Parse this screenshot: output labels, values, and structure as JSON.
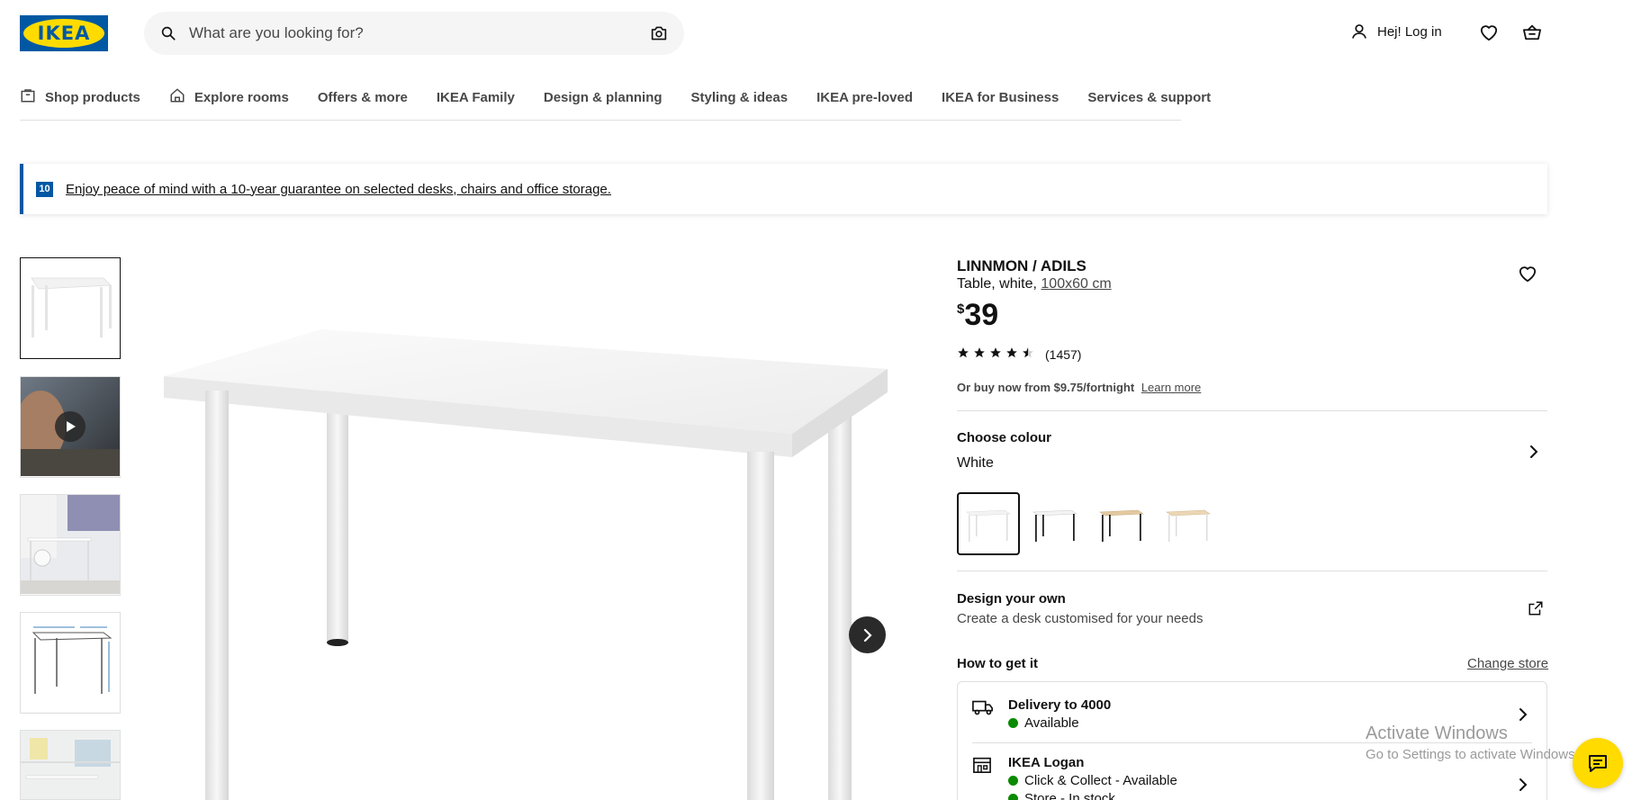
{
  "header": {
    "logo_text": "IKEA",
    "search_placeholder": "What are you looking for?",
    "login_label": "Hej! Log in"
  },
  "nav": {
    "items": [
      {
        "label": "Shop products",
        "icon": "bag-icon"
      },
      {
        "label": "Explore rooms",
        "icon": "house-icon"
      },
      {
        "label": "Offers & more"
      },
      {
        "label": "IKEA Family"
      },
      {
        "label": "Design & planning"
      },
      {
        "label": "Styling & ideas"
      },
      {
        "label": "IKEA pre-loved"
      },
      {
        "label": "IKEA for Business"
      },
      {
        "label": "Services & support"
      }
    ]
  },
  "banner": {
    "badge": "10",
    "text": "Enjoy peace of mind with a 10-year guarantee on selected desks, chairs and office storage."
  },
  "product": {
    "name": "LINNMON / ADILS",
    "desc_prefix": "Table, white,",
    "size": "100x60 cm",
    "currency": "$",
    "price": "39",
    "rating_value": 4.5,
    "rating_count": "(1457)",
    "finance_text": "Or buy now from $9.75/fortnight",
    "learn_more": "Learn more"
  },
  "colour": {
    "label": "Choose colour",
    "value": "White",
    "swatches": [
      "white",
      "white-black legs",
      "oak-black legs",
      "oak-white legs"
    ]
  },
  "design": {
    "title": "Design your own",
    "subtitle": "Create a desk customised for your needs"
  },
  "get_it": {
    "title": "How to get it",
    "change_store": "Change store",
    "delivery_title": "Delivery to 4000",
    "delivery_status": "Available",
    "store_title": "IKEA Logan",
    "store_status": "Click & Collect - Available",
    "store_stock": "Store - In stock"
  },
  "watermark": {
    "line1": "Activate Windows",
    "line2": "Go to Settings to activate Windows."
  },
  "colors": {
    "ikea_blue": "#0058a3",
    "ikea_yellow": "#ffdb00",
    "available_green": "#0a8a00"
  }
}
